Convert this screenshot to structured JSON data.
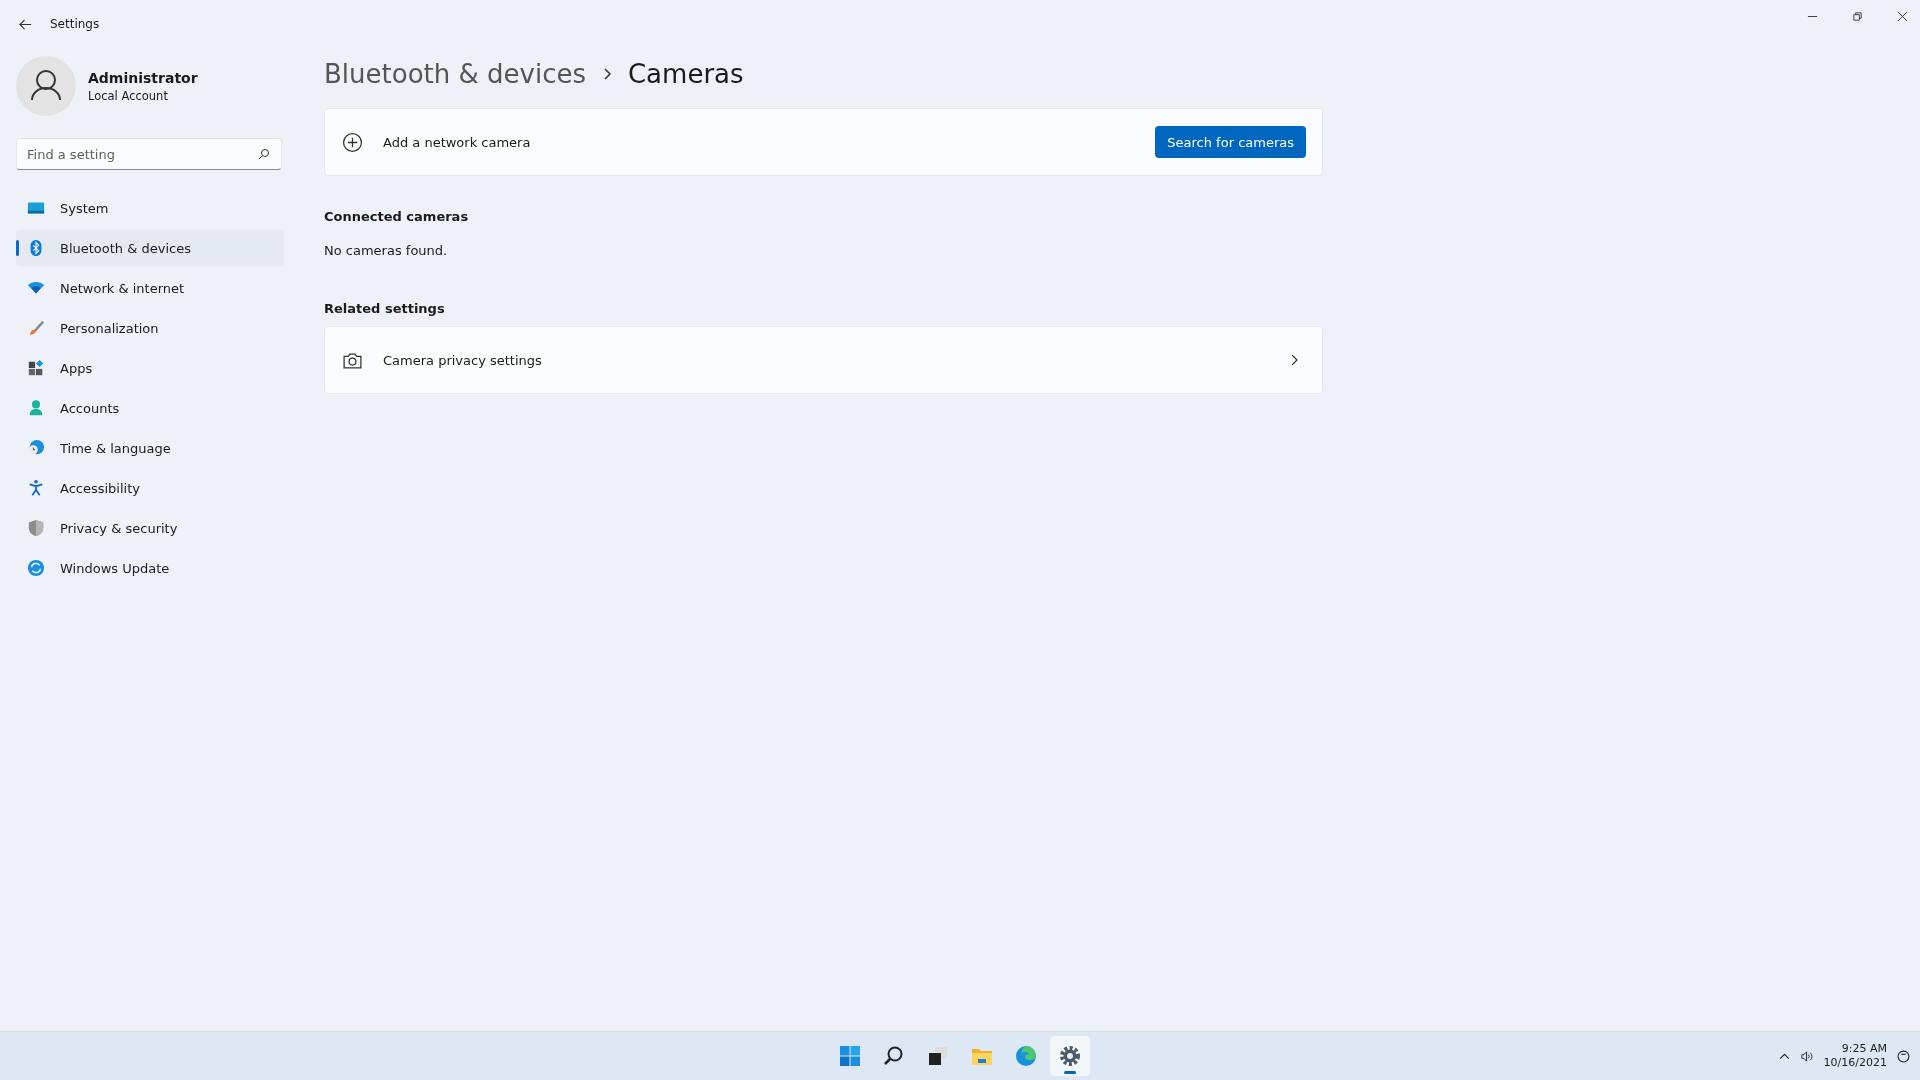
{
  "window": {
    "title": "Settings"
  },
  "account": {
    "name": "Administrator",
    "type": "Local Account"
  },
  "search": {
    "placeholder": "Find a setting"
  },
  "sidebar": {
    "items": [
      {
        "label": "System",
        "selected": false
      },
      {
        "label": "Bluetooth & devices",
        "selected": true
      },
      {
        "label": "Network & internet",
        "selected": false
      },
      {
        "label": "Personalization",
        "selected": false
      },
      {
        "label": "Apps",
        "selected": false
      },
      {
        "label": "Accounts",
        "selected": false
      },
      {
        "label": "Time & language",
        "selected": false
      },
      {
        "label": "Accessibility",
        "selected": false
      },
      {
        "label": "Privacy & security",
        "selected": false
      },
      {
        "label": "Windows Update",
        "selected": false
      }
    ]
  },
  "breadcrumb": [
    "Bluetooth & devices",
    "Cameras"
  ],
  "add_camera": {
    "label": "Add a network camera",
    "button": "Search for cameras"
  },
  "connected": {
    "heading": "Connected cameras",
    "message": "No cameras found."
  },
  "related": {
    "heading": "Related settings",
    "items": [
      {
        "label": "Camera privacy settings"
      }
    ]
  },
  "taskbar": {
    "apps": [
      {
        "selected": false
      },
      {
        "selected": false
      },
      {
        "selected": false
      },
      {
        "selected": false
      },
      {
        "selected": false
      },
      {
        "selected": true
      }
    ],
    "time": "9:25 AM",
    "date": "10/16/2021"
  }
}
